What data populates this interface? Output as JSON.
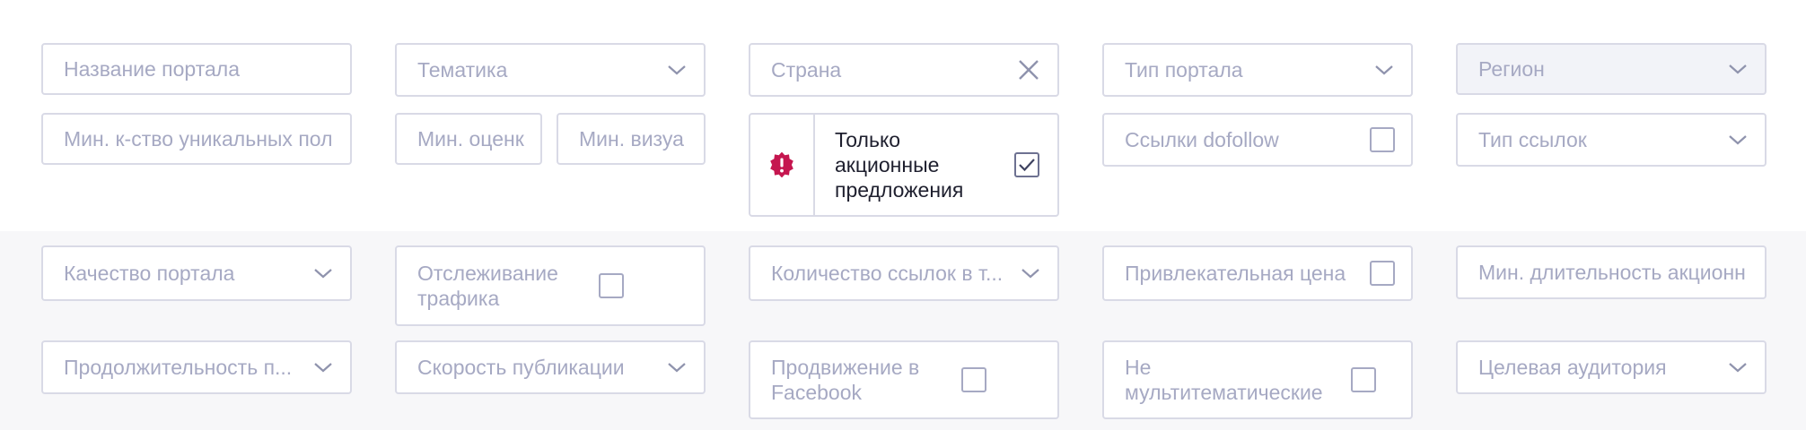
{
  "filters": {
    "portal_name": {
      "placeholder": "Название портала"
    },
    "topic": {
      "placeholder": "Тематика"
    },
    "country": {
      "placeholder": "Страна"
    },
    "portal_type": {
      "placeholder": "Тип портала"
    },
    "region": {
      "placeholder": "Регион",
      "disabled": true
    },
    "min_unique_users": {
      "placeholder": "Мин. к-ство уникальных пол"
    },
    "min_rating": {
      "placeholder": "Мин. оценк"
    },
    "min_visual": {
      "placeholder": "Мин. визуа"
    },
    "promo_only": {
      "label": "Только акционные предложения",
      "checked": true,
      "badge_color": "#c5164f"
    },
    "dofollow_links": {
      "label": "Ссылки dofollow",
      "checked": false
    },
    "link_type": {
      "placeholder": "Тип ссылок"
    },
    "portal_quality": {
      "placeholder": "Качество портала"
    },
    "traffic_tracking": {
      "label": "Отслеживание трафика",
      "checked": false
    },
    "links_in_text": {
      "placeholder": "Количество ссылок в т..."
    },
    "attractive_price": {
      "label": "Привлекательная цена",
      "checked": false
    },
    "min_promo_duration": {
      "placeholder": "Мин. длительность акционн"
    },
    "duration": {
      "placeholder": "Продолжительность п..."
    },
    "publication_speed": {
      "placeholder": "Скорость публикации"
    },
    "facebook_promotion": {
      "label": "Продвижение в Facebook",
      "checked": false
    },
    "not_multithematic": {
      "label": "Не мультитематические",
      "checked": false
    },
    "target_audience": {
      "placeholder": "Целевая аудитория"
    }
  },
  "colors": {
    "border": "#d9dae6",
    "placeholder": "#a6a9c3",
    "bottom_band": "#f7f7f9",
    "promo_badge": "#c5164f"
  }
}
